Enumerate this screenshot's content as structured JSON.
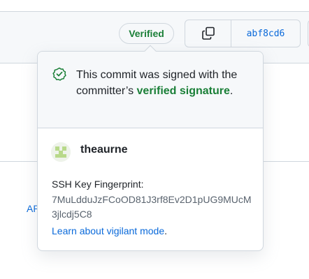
{
  "header": {
    "verified_badge": "Verified",
    "commit_sha": "abf8cd6"
  },
  "background": {
    "link_fragment": "AP"
  },
  "popover": {
    "message_pre": "This commit was signed with the committer’s ",
    "message_strong": "verified signature",
    "message_post": ".",
    "username": "theaurne",
    "fingerprint_label": "SSH Key Fingerprint:",
    "fingerprint_value": "7MuLdduJzFCoOD81J3rf8Ev2D1pUG9MUcM3jlcdj5C8",
    "learn_link": "Learn about vigilant mode",
    "learn_suffix": "."
  },
  "icons": {
    "check": "check-circle-icon",
    "copy": "copy-icon",
    "avatar": "identicon-avatar"
  },
  "colors": {
    "success": "#1a7f37",
    "link": "#0969da",
    "border": "#d0d7de",
    "muted_bg": "#f6f8fa"
  }
}
